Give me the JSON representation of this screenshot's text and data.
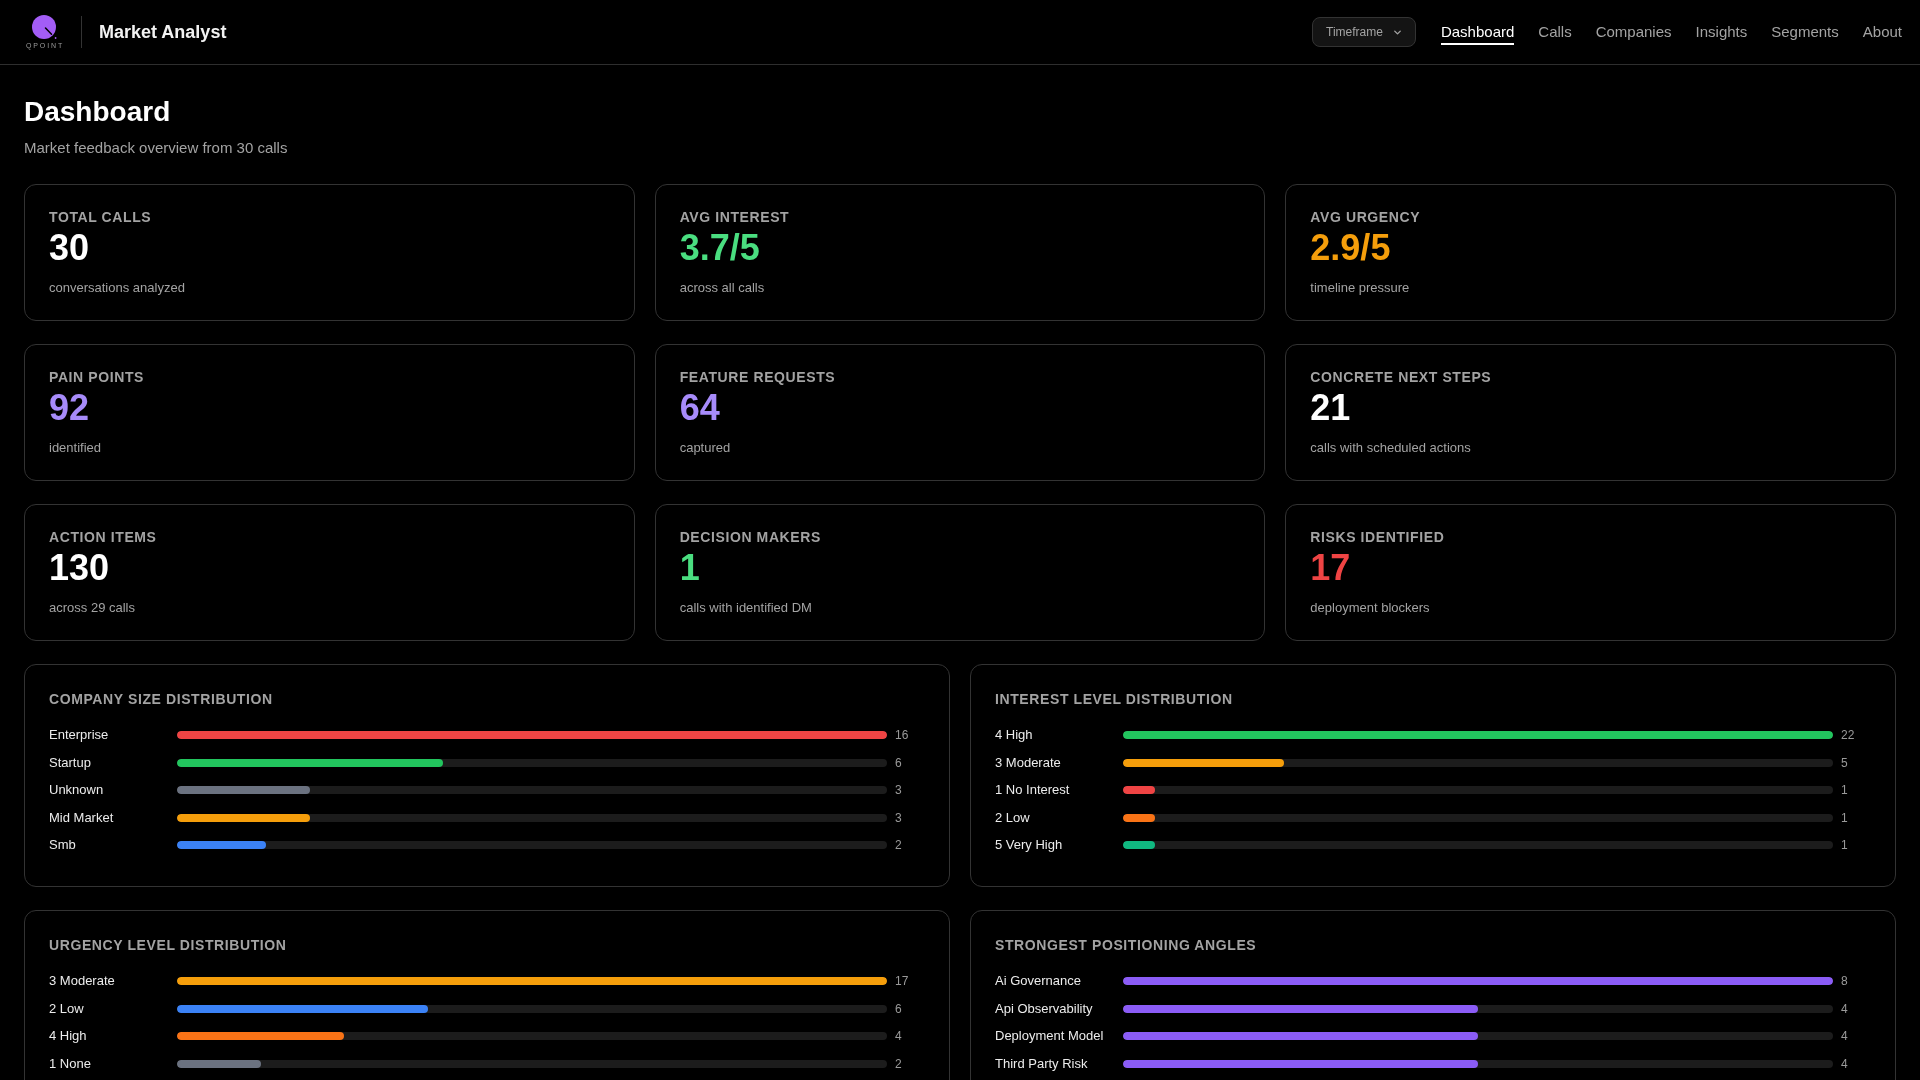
{
  "header": {
    "logo": {
      "text": "QPOINT"
    },
    "app_title": "Market Analyst",
    "timeframe": {
      "label": "Timeframe"
    },
    "nav": [
      {
        "label": "Dashboard",
        "selected": true
      },
      {
        "label": "Calls",
        "selected": false
      },
      {
        "label": "Companies",
        "selected": false
      },
      {
        "label": "Insights",
        "selected": false
      },
      {
        "label": "Segments",
        "selected": false
      },
      {
        "label": "About",
        "selected": false
      }
    ]
  },
  "page": {
    "title": "Dashboard",
    "subtitle": "Market feedback overview from 30 calls"
  },
  "stats": [
    {
      "label": "TOTAL CALLS",
      "value": "30",
      "caption": "conversations analyzed",
      "color": "#ffffff"
    },
    {
      "label": "AVG INTEREST",
      "value": "3.7/5",
      "caption": "across all calls",
      "color": "#4ade80"
    },
    {
      "label": "AVG URGENCY",
      "value": "2.9/5",
      "caption": "timeline pressure",
      "color": "#f59e0b"
    },
    {
      "label": "PAIN POINTS",
      "value": "92",
      "caption": "identified",
      "color": "#a78bfa"
    },
    {
      "label": "FEATURE REQUESTS",
      "value": "64",
      "caption": "captured",
      "color": "#a78bfa"
    },
    {
      "label": "CONCRETE NEXT STEPS",
      "value": "21",
      "caption": "calls with scheduled actions",
      "color": "#ffffff"
    },
    {
      "label": "ACTION ITEMS",
      "value": "130",
      "caption": "across 29 calls",
      "color": "#ffffff"
    },
    {
      "label": "DECISION MAKERS",
      "value": "1",
      "caption": "calls with identified DM",
      "color": "#4ade80"
    },
    {
      "label": "RISKS IDENTIFIED",
      "value": "17",
      "caption": "deployment blockers",
      "color": "#ef4444"
    }
  ],
  "panels": [
    {
      "title": "COMPANY SIZE DISTRIBUTION",
      "rows": [
        {
          "label": "Enterprise",
          "count": "16",
          "level": 1,
          "color": "#ef4444"
        },
        {
          "label": "Startup",
          "count": "6",
          "level": 0.375,
          "color": "#22c55e"
        },
        {
          "label": "Unknown",
          "count": "3",
          "level": 0.1875,
          "color": "#6b7280"
        },
        {
          "label": "Mid Market",
          "count": "3",
          "level": 0.1875,
          "color": "#f59e0b"
        },
        {
          "label": "Smb",
          "count": "2",
          "level": 0.125,
          "color": "#3b82f6"
        }
      ]
    },
    {
      "title": "INTEREST LEVEL DISTRIBUTION",
      "rows": [
        {
          "label": "4 High",
          "count": "22",
          "level": 1,
          "color": "#22c55e"
        },
        {
          "label": "3 Moderate",
          "count": "5",
          "level": 0.227,
          "color": "#f59e0b"
        },
        {
          "label": "1 No Interest",
          "count": "1",
          "level": 0.045,
          "color": "#ef4444"
        },
        {
          "label": "2 Low",
          "count": "1",
          "level": 0.045,
          "color": "#f97316"
        },
        {
          "label": "5 Very High",
          "count": "1",
          "level": 0.045,
          "color": "#10b981"
        }
      ]
    },
    {
      "title": "URGENCY LEVEL DISTRIBUTION",
      "rows": [
        {
          "label": "3 Moderate",
          "count": "17",
          "level": 1,
          "color": "#f59e0b"
        },
        {
          "label": "2 Low",
          "count": "6",
          "level": 0.353,
          "color": "#3b82f6"
        },
        {
          "label": "4 High",
          "count": "4",
          "level": 0.235,
          "color": "#f97316"
        },
        {
          "label": "1 None",
          "count": "2",
          "level": 0.118,
          "color": "#6b7280"
        }
      ]
    },
    {
      "title": "STRONGEST POSITIONING ANGLES",
      "rows": [
        {
          "label": "Ai Governance",
          "count": "8",
          "level": 1
        },
        {
          "label": "Api Observability",
          "count": "4",
          "level": 0.5
        },
        {
          "label": "Deployment Model",
          "count": "4",
          "level": 0.5
        },
        {
          "label": "Third Party Risk",
          "count": "4",
          "level": 0.5
        }
      ]
    }
  ]
}
